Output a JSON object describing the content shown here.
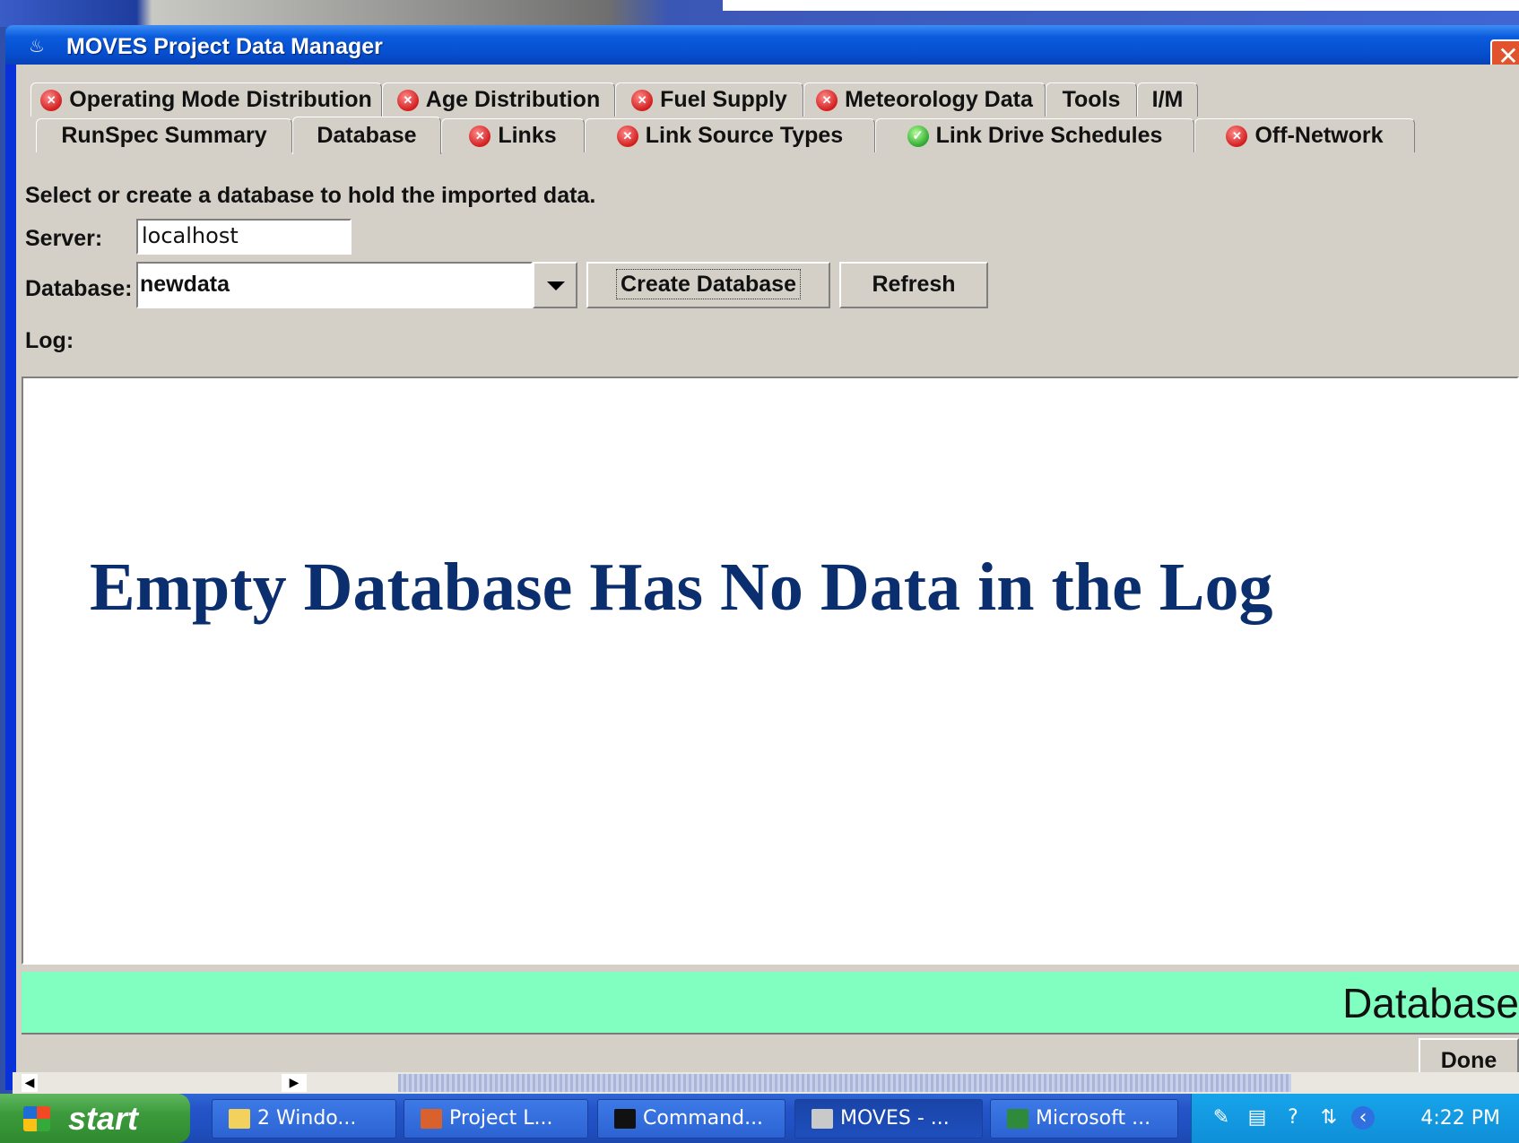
{
  "window": {
    "title": "MOVES Project Data Manager"
  },
  "tabs_row1": [
    {
      "label": "Operating Mode Distribution",
      "status": "error"
    },
    {
      "label": "Age Distribution",
      "status": "error"
    },
    {
      "label": "Fuel Supply",
      "status": "error"
    },
    {
      "label": "Meteorology Data",
      "status": "error"
    },
    {
      "label": "Tools",
      "status": "none"
    },
    {
      "label": "I/M",
      "status": "none"
    }
  ],
  "tabs_row2": [
    {
      "label": "RunSpec Summary",
      "status": "none"
    },
    {
      "label": "Database",
      "status": "none",
      "active": true
    },
    {
      "label": "Links",
      "status": "error"
    },
    {
      "label": "Link Source Types",
      "status": "error"
    },
    {
      "label": "Link Drive Schedules",
      "status": "ok"
    },
    {
      "label": "Off-Network",
      "status": "error"
    }
  ],
  "database_panel": {
    "instruction": "Select or create a database to hold the imported data.",
    "server_label": "Server:",
    "server_value": "localhost",
    "database_label": "Database:",
    "database_value": "newdata",
    "create_button": "Create Database",
    "refresh_button": "Refresh",
    "log_label": "Log:"
  },
  "overlay_caption": "Empty Database Has No Data in the Log",
  "status_bar": {
    "text": "Database",
    "color": "#80ffc0"
  },
  "done_button": "Done",
  "taskbar": {
    "start_label": "start",
    "tasks": [
      {
        "label": "2 Windo...",
        "icon": "folder-icon"
      },
      {
        "label": "Project L...",
        "icon": "powerpoint-icon"
      },
      {
        "label": "Command...",
        "icon": "console-icon"
      },
      {
        "label": "MOVES - ...",
        "icon": "java-icon",
        "active": true
      },
      {
        "label": "Microsoft ...",
        "icon": "excel-icon"
      }
    ],
    "clock": "4:22 PM"
  }
}
